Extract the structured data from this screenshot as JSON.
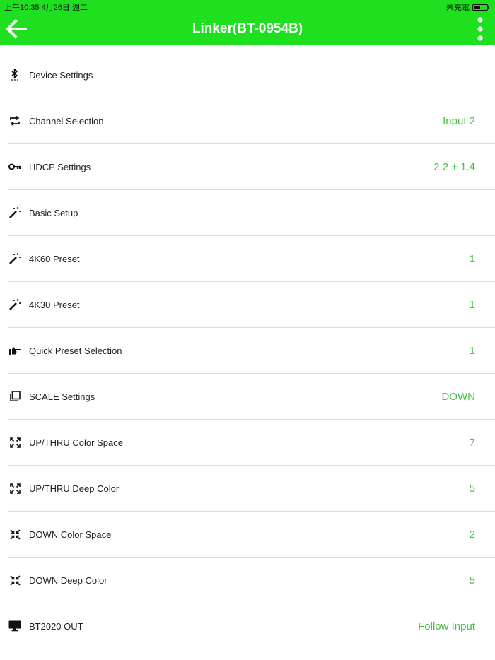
{
  "status_bar": {
    "left": "上午10:35   4月26日 週二",
    "right": "未充電",
    "battery_level": 0.45
  },
  "header": {
    "title": "Linker(BT-0954B)"
  },
  "colors": {
    "accent": "#1fe01f",
    "value_text": "#3ec43e"
  },
  "settings": [
    {
      "label": "Device Settings",
      "value": "",
      "icon": "bluetooth-icon"
    },
    {
      "label": "Channel Selection",
      "value": "Input 2",
      "icon": "swap-icon"
    },
    {
      "label": "HDCP Settings",
      "value": "2.2 + 1.4",
      "icon": "key-icon"
    },
    {
      "label": "Basic Setup",
      "value": "",
      "icon": "magic-wand-icon"
    },
    {
      "label": "4K60 Preset",
      "value": "1",
      "icon": "magic-wand-icon"
    },
    {
      "label": "4K30 Preset",
      "value": "1",
      "icon": "magic-wand-icon"
    },
    {
      "label": "Quick Preset Selection",
      "value": "1",
      "icon": "pointing-hand-icon"
    },
    {
      "label": "SCALE Settings",
      "value": "DOWN",
      "icon": "copy-icon"
    },
    {
      "label": "UP/THRU Color Space",
      "value": "7",
      "icon": "expand-icon"
    },
    {
      "label": "UP/THRU Deep Color",
      "value": "5",
      "icon": "expand-icon"
    },
    {
      "label": "DOWN Color Space",
      "value": "2",
      "icon": "compress-icon"
    },
    {
      "label": "DOWN Deep Color",
      "value": "5",
      "icon": "compress-icon"
    },
    {
      "label": "BT2020 OUT",
      "value": "Follow Input",
      "icon": "monitor-icon"
    }
  ]
}
